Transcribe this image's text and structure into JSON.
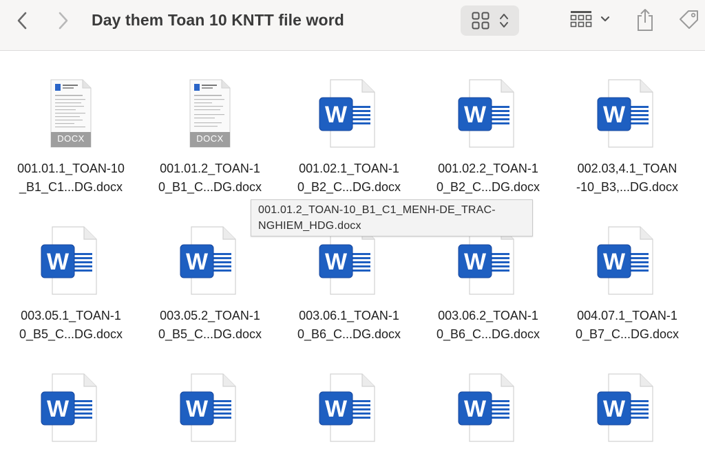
{
  "window": {
    "title": "Day them Toan 10 KNTT file word"
  },
  "toolbar": {
    "back_icon": "chevron-left-icon",
    "forward_icon": "chevron-right-icon",
    "view_icon": "icon-grid-icon",
    "group_icon": "group-by-icon",
    "share_icon": "share-icon",
    "tag_icon": "tag-icon"
  },
  "files": [
    {
      "line1": "001.01.1_TOAN-10",
      "line2": "_B1_C1...DG.docx",
      "thumb": "preview",
      "badge": "DOCX"
    },
    {
      "line1": "001.01.2_TOAN-1",
      "line2": "0_B1_C...DG.docx",
      "thumb": "preview",
      "badge": "DOCX"
    },
    {
      "line1": "001.02.1_TOAN-1",
      "line2": "0_B2_C...DG.docx",
      "thumb": "word"
    },
    {
      "line1": "001.02.2_TOAN-1",
      "line2": "0_B2_C...DG.docx",
      "thumb": "word"
    },
    {
      "line1": "002.03,4.1_TOAN",
      "line2": "-10_B3,...DG.docx",
      "thumb": "word"
    },
    {
      "line1": "003.05.1_TOAN-1",
      "line2": "0_B5_C...DG.docx",
      "thumb": "word"
    },
    {
      "line1": "003.05.2_TOAN-1",
      "line2": "0_B5_C...DG.docx",
      "thumb": "word"
    },
    {
      "line1": "003.06.1_TOAN-1",
      "line2": "0_B6_C...DG.docx",
      "thumb": "word"
    },
    {
      "line1": "003.06.2_TOAN-1",
      "line2": "0_B6_C...DG.docx",
      "thumb": "word"
    },
    {
      "line1": "004.07.1_TOAN-1",
      "line2": "0_B7_C...DG.docx",
      "thumb": "word"
    },
    {
      "line1": "",
      "line2": "",
      "thumb": "word"
    },
    {
      "line1": "",
      "line2": "",
      "thumb": "word"
    },
    {
      "line1": "",
      "line2": "",
      "thumb": "word"
    },
    {
      "line1": "",
      "line2": "",
      "thumb": "word"
    },
    {
      "line1": "",
      "line2": "",
      "thumb": "word"
    }
  ],
  "tooltip": {
    "line1": "001.01.2_TOAN-10_B1_C1_MENH-DE_TRAC-",
    "line2": "NGHIEM_HDG.docx"
  },
  "colors": {
    "word_blue": "#1e5fc1",
    "word_dark": "#17479e",
    "toolbar_bg": "#f7f6f5"
  }
}
